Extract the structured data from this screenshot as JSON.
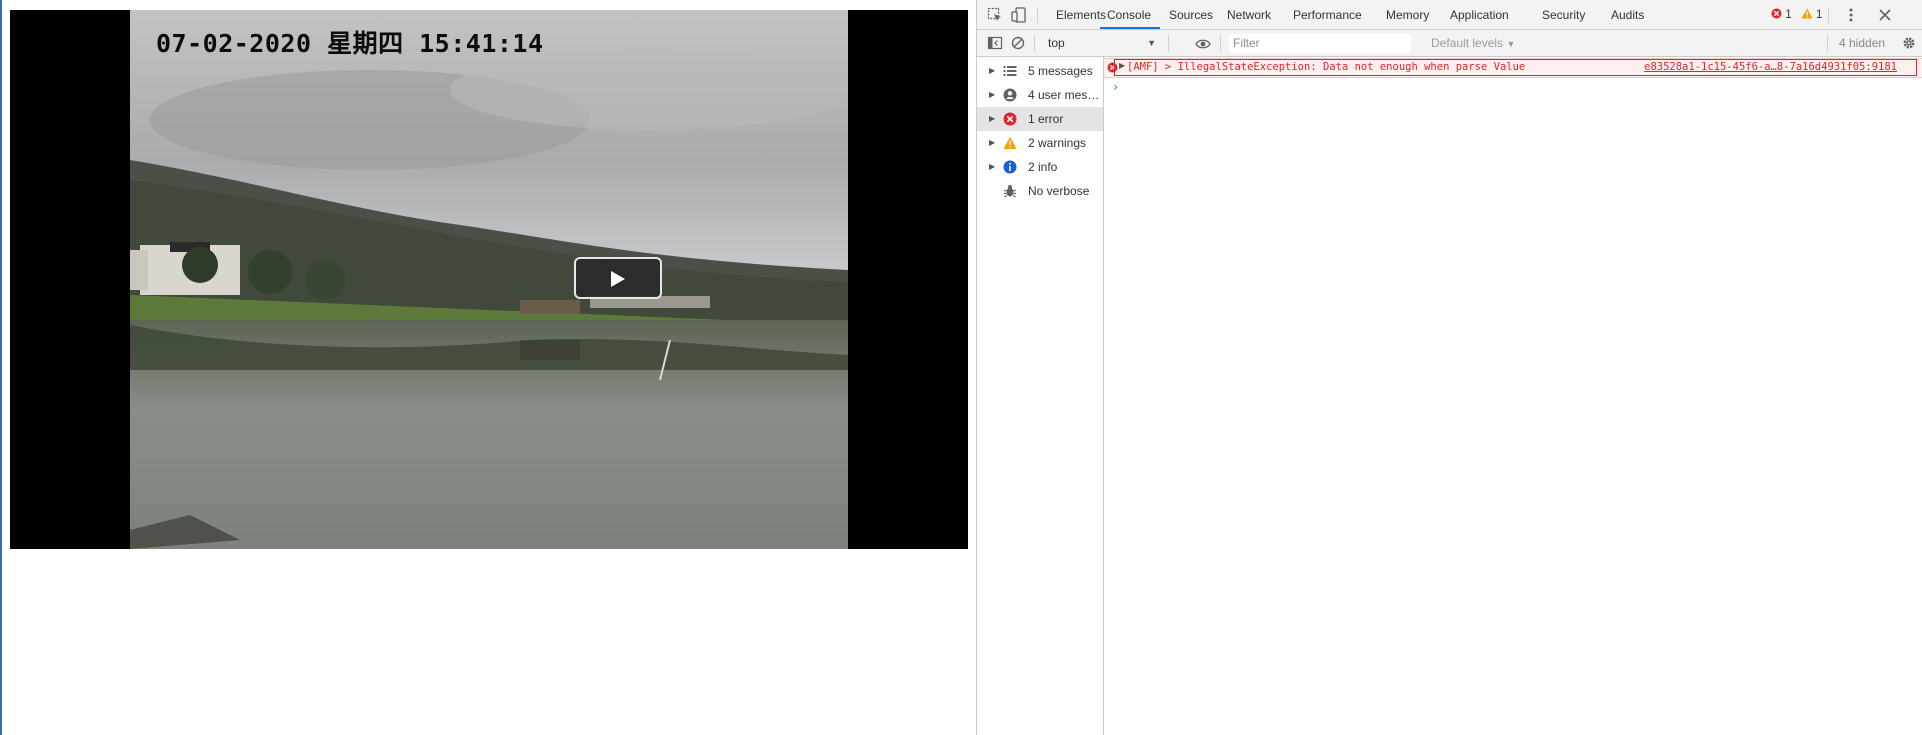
{
  "video": {
    "osd_timestamp": "07-02-2020 星期四 15:41:14"
  },
  "devtools": {
    "tabs": [
      "Elements",
      "Console",
      "Sources",
      "Network",
      "Performance",
      "Memory",
      "Application",
      "Security",
      "Audits"
    ],
    "active_tab": "Console",
    "error_count": "1",
    "warning_count": "1",
    "context": "top",
    "filter_placeholder": "Filter",
    "levels": "Default levels",
    "hidden_count": "4 hidden",
    "sidebar": [
      {
        "label": "5 messages",
        "icon": "list-icon"
      },
      {
        "label": "4 user messages",
        "icon": "user-icon"
      },
      {
        "label": "1 error",
        "icon": "error-icon"
      },
      {
        "label": "2 warnings",
        "icon": "warning-icon"
      },
      {
        "label": "2 info",
        "icon": "info-icon"
      },
      {
        "label": "No verbose",
        "icon": "bug-icon"
      }
    ],
    "console": {
      "error_message": "[AMF] > IllegalStateException: Data not enough when parse Value",
      "error_source": "e83528a1-1c15-45f6-a…8-7a16d4931f05:9181",
      "prompt": "›"
    }
  },
  "colors": {
    "accent": "#1a73e8",
    "error": "#e0242a",
    "warning": "#f2a100",
    "toolbar_bg": "#f3f3f3"
  }
}
